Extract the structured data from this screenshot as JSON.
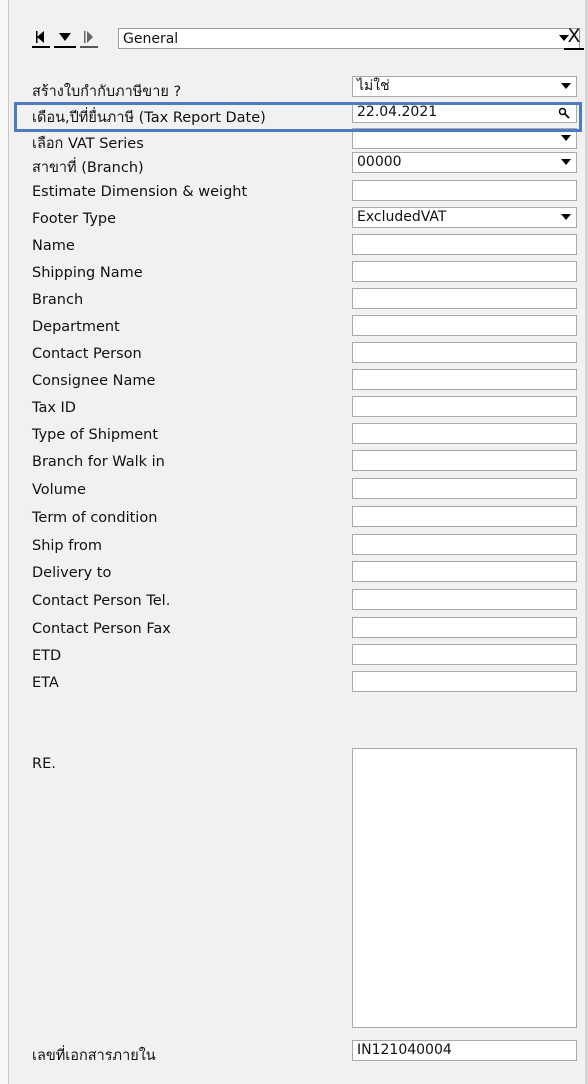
{
  "toolbar": {
    "section": "General",
    "close": "X"
  },
  "rows": [
    {
      "label": "สร้างใบกำกับภาษีขาย ?",
      "value": "ไม่ใช่",
      "kind": "dropdown"
    },
    {
      "label": "เดือน,ปีที่ยื่นภาษี (Tax Report Date)",
      "value": "22.04.2021",
      "kind": "lookup"
    },
    {
      "label": "เลือก VAT Series",
      "value": "",
      "kind": "dropdown"
    },
    {
      "label": "สาขาที่ (Branch)",
      "value": "00000",
      "kind": "dropdown"
    },
    {
      "label": "Estimate Dimension & weight",
      "value": "",
      "kind": "text"
    },
    {
      "label": "Footer Type",
      "value": "ExcludedVAT",
      "kind": "dropdown"
    },
    {
      "label": "Name",
      "value": "",
      "kind": "text"
    },
    {
      "label": "Shipping Name",
      "value": "",
      "kind": "text"
    },
    {
      "label": "Branch",
      "value": "",
      "kind": "text"
    },
    {
      "label": "Department",
      "value": "",
      "kind": "text"
    },
    {
      "label": "Contact Person",
      "value": "",
      "kind": "text"
    },
    {
      "label": "Consignee Name",
      "value": "",
      "kind": "text"
    },
    {
      "label": "Tax ID",
      "value": "",
      "kind": "text"
    },
    {
      "label": "Type of Shipment",
      "value": "",
      "kind": "text"
    },
    {
      "label": "Branch for Walk in",
      "value": "",
      "kind": "text"
    },
    {
      "label": "Volume",
      "value": "",
      "kind": "text"
    },
    {
      "label": "Term of condition",
      "value": "",
      "kind": "text"
    },
    {
      "label": "Ship from",
      "value": "",
      "kind": "text"
    },
    {
      "label": "Delivery to",
      "value": "",
      "kind": "text"
    },
    {
      "label": "Contact Person Tel.",
      "value": "",
      "kind": "text"
    },
    {
      "label": "Contact Person Fax",
      "value": "",
      "kind": "text"
    },
    {
      "label": "ETD",
      "value": "",
      "kind": "text"
    },
    {
      "label": "ETA",
      "value": "",
      "kind": "text"
    }
  ],
  "re_label": "RE.",
  "re_value": "",
  "doc_no": {
    "label": "เลขที่เอกสารภายใน",
    "value": "IN121040004"
  }
}
